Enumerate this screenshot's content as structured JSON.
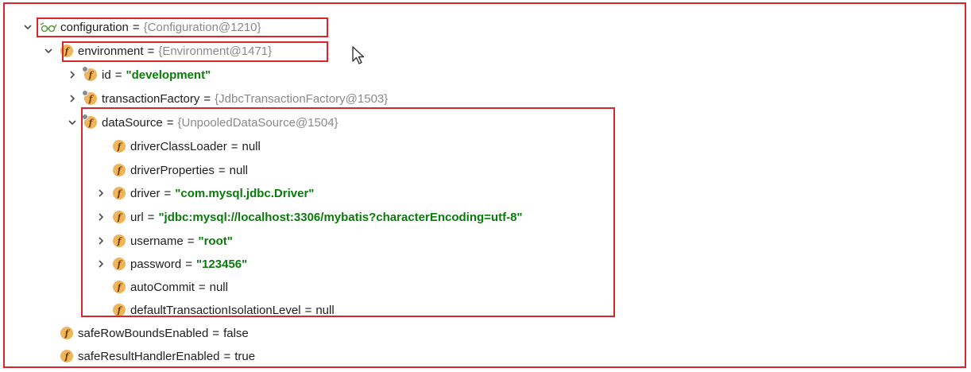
{
  "tree": {
    "configuration": {
      "name": "configuration",
      "value": "{Configuration@1210}"
    },
    "environment": {
      "name": "environment",
      "value": "{Environment@1471}"
    },
    "id": {
      "name": "id",
      "value": "\"development\""
    },
    "transactionFactory": {
      "name": "transactionFactory",
      "value": "{JdbcTransactionFactory@1503}"
    },
    "dataSource": {
      "name": "dataSource",
      "value": "{UnpooledDataSource@1504}"
    },
    "driverClassLoader": {
      "name": "driverClassLoader",
      "value": "null"
    },
    "driverProperties": {
      "name": "driverProperties",
      "value": "null"
    },
    "driver": {
      "name": "driver",
      "value": "\"com.mysql.jdbc.Driver\""
    },
    "url": {
      "name": "url",
      "value": "\"jdbc:mysql://localhost:3306/mybatis?characterEncoding=utf-8\""
    },
    "username": {
      "name": "username",
      "value": "\"root\""
    },
    "password": {
      "name": "password",
      "value": "\"123456\""
    },
    "autoCommit": {
      "name": "autoCommit",
      "value": "null"
    },
    "defaultTransactionIsolationLevel": {
      "name": "defaultTransactionIsolationLevel",
      "value": "null"
    },
    "safeRowBoundsEnabled": {
      "name": "safeRowBoundsEnabled",
      "value": "false"
    },
    "safeResultHandlerEnabled": {
      "name": "safeResultHandlerEnabled",
      "value": "true"
    }
  },
  "symbols": {
    "equals": "=",
    "field_icon_letter": "f"
  },
  "colors": {
    "highlight_border": "#d7262e",
    "string_value": "#0a7a0a",
    "reference_value": "#8a8a8a",
    "field_icon": "#f0b45b"
  },
  "icons": {
    "expand_open": "chevron-down-icon",
    "expand_closed": "chevron-right-icon",
    "field": "field-icon",
    "watch": "glasses-icon",
    "pointer": "mouse-cursor-icon"
  }
}
